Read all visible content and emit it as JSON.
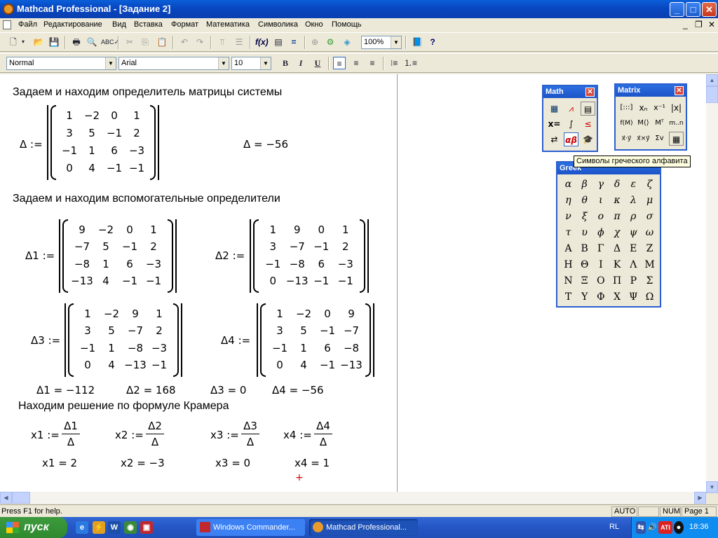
{
  "window": {
    "title": "Mathcad Professional - [Задание 2]",
    "controls": {
      "minimize": "_",
      "maximize": "□",
      "close": "✕"
    }
  },
  "menu": {
    "items": [
      "Файл",
      "Редактирование",
      "Вид",
      "Вставка",
      "Формат",
      "Математика",
      "Символика",
      "Окно",
      "Помощь"
    ],
    "mdi_controls": {
      "minimize": "_",
      "restore": "❐",
      "close": "✕"
    }
  },
  "toolbar": {
    "zoom": "100%",
    "style": "Normal",
    "font": "Arial",
    "font_size": "10",
    "bold": "B",
    "italic": "I",
    "underline": "U"
  },
  "document": {
    "heading1": "Задаем и находим определитель матрицы системы",
    "delta_def": "Δ :=",
    "delta_matrix": [
      [
        "1",
        "−2",
        "0",
        "1"
      ],
      [
        "3",
        "5",
        "−1",
        "2"
      ],
      [
        "−1",
        "1",
        "6",
        "−3"
      ],
      [
        "0",
        "4",
        "−1",
        "−1"
      ]
    ],
    "delta_result": "Δ = −56",
    "heading2": "Задаем и находим вспомогательные определители",
    "d1_def": "Δ1 :=",
    "d1_matrix": [
      [
        "9",
        "−2",
        "0",
        "1"
      ],
      [
        "−7",
        "5",
        "−1",
        "2"
      ],
      [
        "−8",
        "1",
        "6",
        "−3"
      ],
      [
        "−13",
        "4",
        "−1",
        "−1"
      ]
    ],
    "d2_def": "Δ2 :=",
    "d2_matrix": [
      [
        "1",
        "9",
        "0",
        "1"
      ],
      [
        "3",
        "−7",
        "−1",
        "2"
      ],
      [
        "−1",
        "−8",
        "6",
        "−3"
      ],
      [
        "0",
        "−13",
        "−1",
        "−1"
      ]
    ],
    "d3_def": "Δ3 :=",
    "d3_matrix": [
      [
        "1",
        "−2",
        "9",
        "1"
      ],
      [
        "3",
        "5",
        "−7",
        "2"
      ],
      [
        "−1",
        "1",
        "−8",
        "−3"
      ],
      [
        "0",
        "4",
        "−13",
        "−1"
      ]
    ],
    "d4_def": "Δ4 :=",
    "d4_matrix": [
      [
        "1",
        "−2",
        "0",
        "9"
      ],
      [
        "3",
        "5",
        "−1",
        "−7"
      ],
      [
        "−1",
        "1",
        "6",
        "−8"
      ],
      [
        "0",
        "4",
        "−1",
        "−13"
      ]
    ],
    "results": [
      "Δ1 = −112",
      "Δ2 = 168",
      "Δ3 = 0",
      "Δ4 = −56"
    ],
    "heading3": "Находим решение по формуле Крамера",
    "solutions": [
      {
        "def": "x1 :=",
        "num": "Δ1",
        "den": "Δ",
        "result": "x1 = 2"
      },
      {
        "def": "x2 :=",
        "num": "Δ2",
        "den": "Δ",
        "result": "x2 = −3"
      },
      {
        "def": "x3 :=",
        "num": "Δ3",
        "den": "Δ",
        "result": "x3 = 0"
      },
      {
        "def": "x4 :=",
        "num": "Δ4",
        "den": "Δ",
        "result": "x4 = 1"
      }
    ],
    "cursor": "+"
  },
  "palettes": {
    "math": {
      "title": "Math"
    },
    "matrix": {
      "title": "Matrix",
      "buttons": [
        "[:::]",
        "xₙ",
        "x⁻¹",
        "|x|",
        "f(M)",
        "M⟨⟩",
        "Mᵀ",
        "m..n",
        "x⃗·y⃗",
        "x⃗×y⃗",
        "Σv",
        "▦"
      ]
    },
    "greek": {
      "title": "Greek",
      "letters": [
        "α",
        "β",
        "γ",
        "δ",
        "ε",
        "ζ",
        "η",
        "θ",
        "ι",
        "κ",
        "λ",
        "μ",
        "ν",
        "ξ",
        "ο",
        "π",
        "ρ",
        "σ",
        "τ",
        "υ",
        "ϕ",
        "χ",
        "ψ",
        "ω"
      ],
      "upper": [
        "Α",
        "Β",
        "Γ",
        "Δ",
        "Ε",
        "Ζ",
        "Η",
        "Θ",
        "Ι",
        "Κ",
        "Λ",
        "Μ",
        "Ν",
        "Ξ",
        "Ο",
        "Π",
        "Ρ",
        "Σ",
        "Τ",
        "Υ",
        "Φ",
        "Χ",
        "Ψ",
        "Ω"
      ]
    },
    "tooltip": "Символы греческого алфавита"
  },
  "status": {
    "help": "Press F1 for help.",
    "auto": "AUTO",
    "num": "NUM",
    "page": "Page 1"
  },
  "taskbar": {
    "start": "пуск",
    "tasks": [
      "Windows Commander...",
      "Mathcad Professional..."
    ],
    "lang": "RL",
    "time": "18:36"
  }
}
